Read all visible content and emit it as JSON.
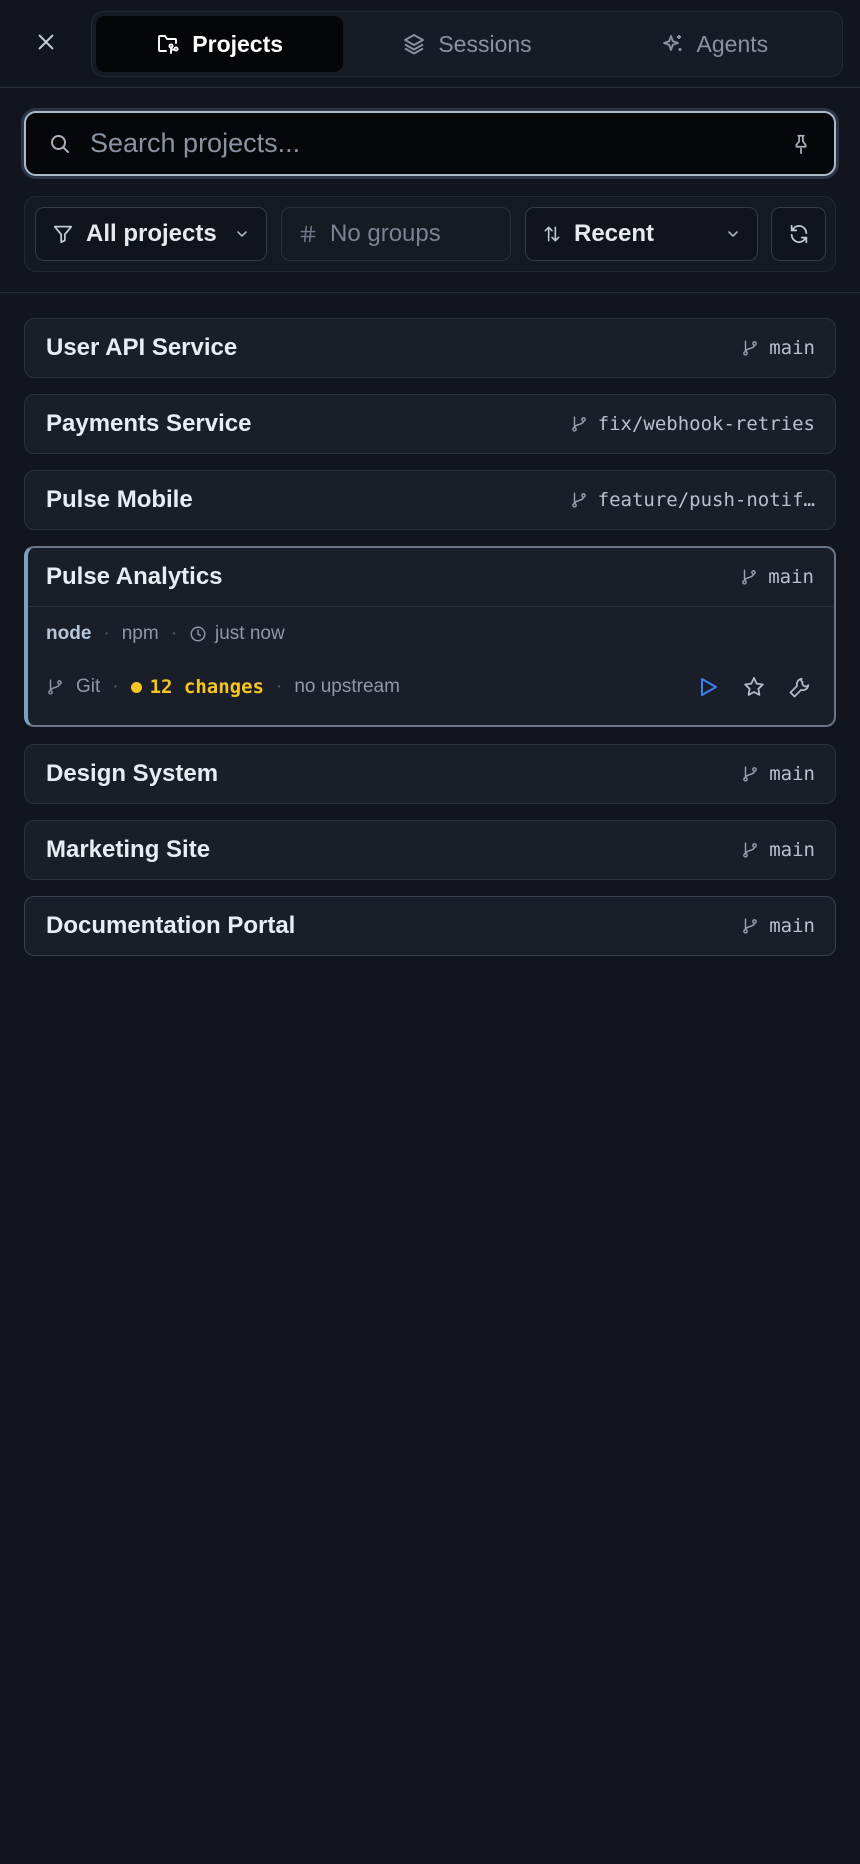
{
  "tabs": [
    {
      "label": "Projects",
      "icon": "folder-git-icon",
      "active": true
    },
    {
      "label": "Sessions",
      "icon": "layers-icon",
      "active": false
    },
    {
      "label": "Agents",
      "icon": "sparkles-icon",
      "active": false
    }
  ],
  "search": {
    "placeholder": "Search projects...",
    "value": ""
  },
  "filters": {
    "scope_label": "All projects",
    "groups_label": "No groups",
    "sort_label": "Recent"
  },
  "projects": [
    {
      "name": "User API Service",
      "branch": "main"
    },
    {
      "name": "Payments Service",
      "branch": "fix/webhook-retries"
    },
    {
      "name": "Pulse Mobile",
      "branch": "feature/push-notif…"
    },
    {
      "name": "Pulse Analytics",
      "branch": "main",
      "expanded": true,
      "tech": "node",
      "package_manager": "npm",
      "updated": "just now",
      "vcs": "Git",
      "changes": "12 changes",
      "upstream": "no upstream"
    },
    {
      "name": "Design System",
      "branch": "main"
    },
    {
      "name": "Marketing Site",
      "branch": "main"
    },
    {
      "name": "Documentation Portal",
      "branch": "main"
    }
  ],
  "meta_separator": "·",
  "colors": {
    "accent_blue": "#3b82f6",
    "changes_yellow": "#f5c523",
    "expanded_border": "#7ea0c6"
  }
}
